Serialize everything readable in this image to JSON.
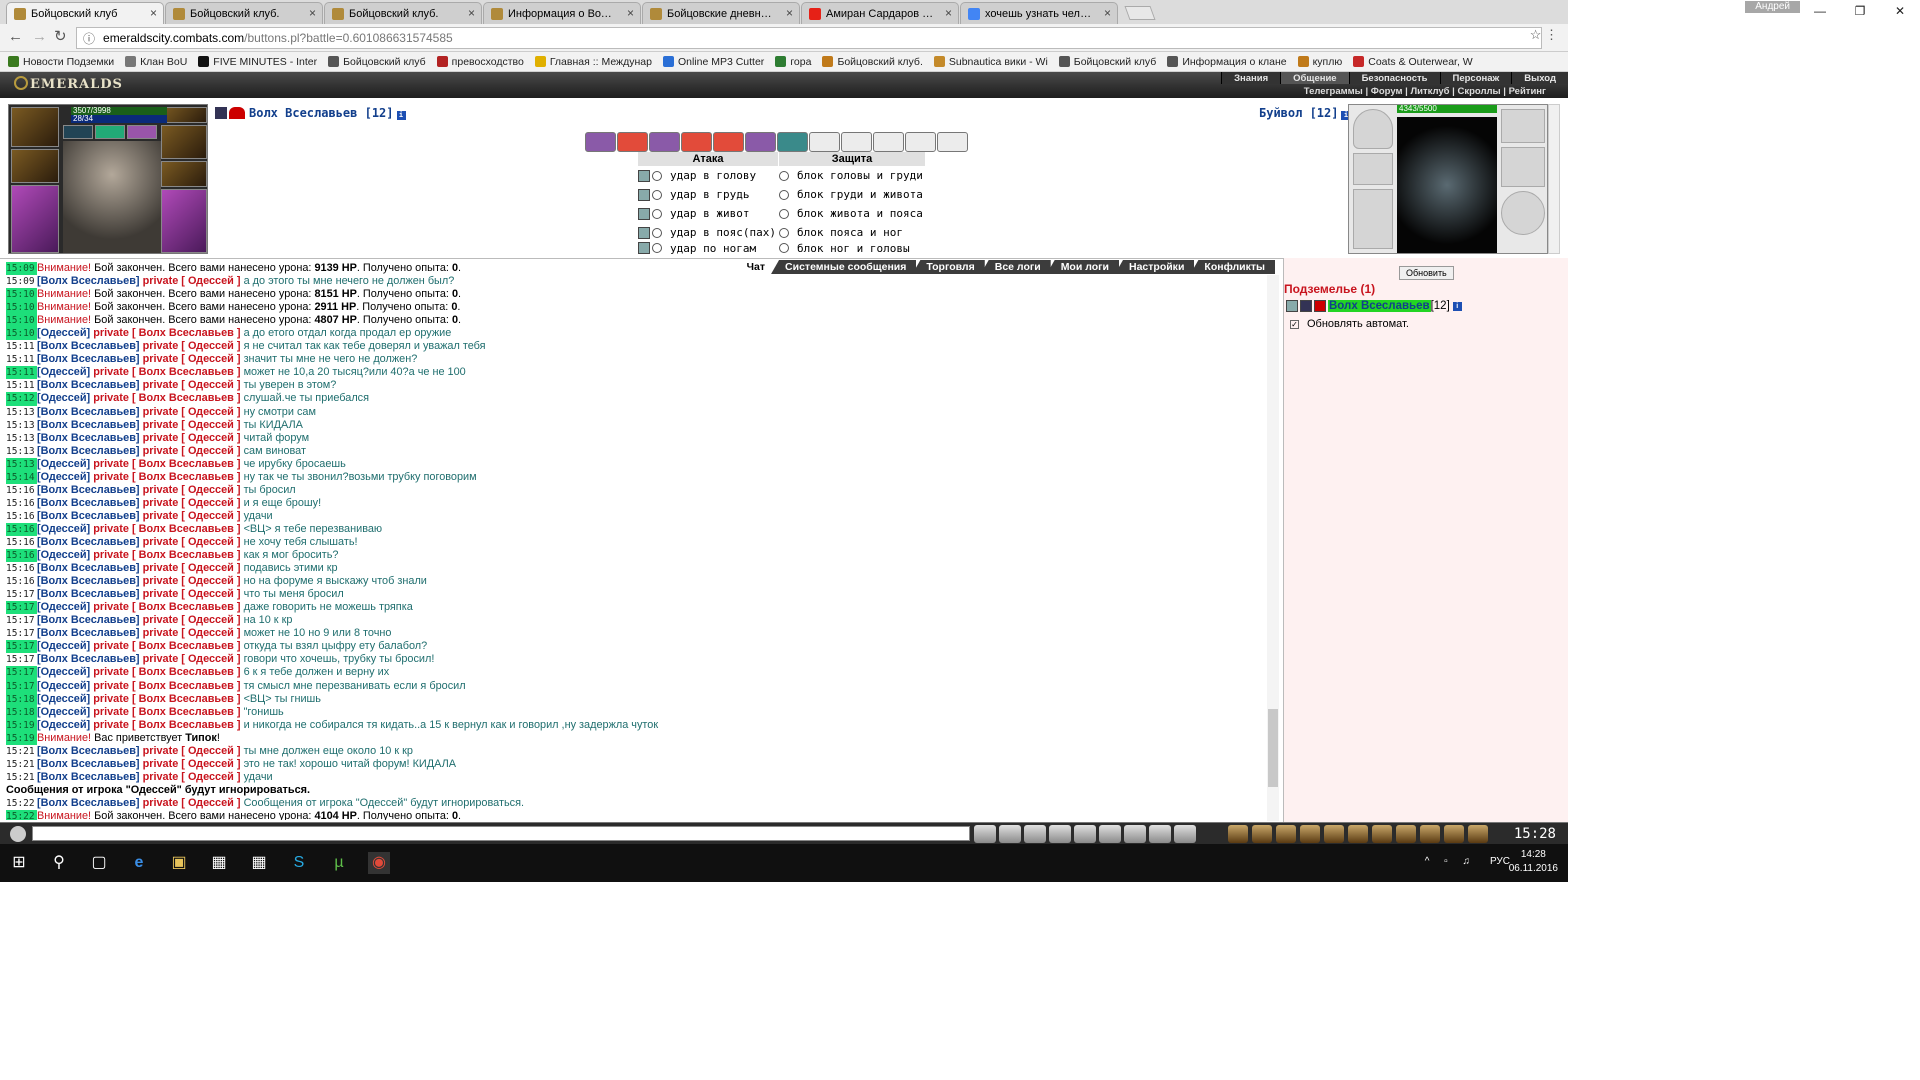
{
  "browser": {
    "tabs": [
      {
        "title": "Бойцовский клуб",
        "icon": "crossed-swords-icon",
        "active": true
      },
      {
        "title": "Бойцовский клуб.",
        "icon": "bear-claw-icon"
      },
      {
        "title": "Бойцовский клуб.",
        "icon": "bear-claw-icon"
      },
      {
        "title": "Информация о Волх Все",
        "icon": "crossed-swords-icon"
      },
      {
        "title": "Бойцовские дневники -",
        "icon": "bookmark-icon"
      },
      {
        "title": "Амиран Сардаров - Му",
        "icon": "youtube-icon"
      },
      {
        "title": "хочешь узнать человек",
        "icon": "google-icon"
      }
    ],
    "user": "Андрей",
    "url_host": "emeraldscity.combats.com",
    "url_rest": "/buttons.pl?battle=0.601086631574585",
    "bookmarks": [
      {
        "label": "Новости Подземки",
        "color": "#3a7a1f"
      },
      {
        "label": "Клан BoU",
        "color": "#777777"
      },
      {
        "label": "FIVE MINUTES - Inter",
        "color": "#111111"
      },
      {
        "label": "Бойцовский клуб",
        "color": "#555555"
      },
      {
        "label": "превосходство",
        "color": "#b22222"
      },
      {
        "label": "Главная :: Междунар",
        "color": "#e0b000"
      },
      {
        "label": "Online MP3 Cutter",
        "color": "#2a6fd6"
      },
      {
        "label": "гора",
        "color": "#2e7d32"
      },
      {
        "label": "Бойцовский клуб.",
        "color": "#c07a1a"
      },
      {
        "label": "Subnautica вики - Wi",
        "color": "#c48a2a"
      },
      {
        "label": "Бойцовский клуб",
        "color": "#555555"
      },
      {
        "label": "Информация о клане",
        "color": "#555555"
      },
      {
        "label": "куплю",
        "color": "#c07a1a"
      },
      {
        "label": "Coats & Outerwear, W",
        "color": "#c62828"
      }
    ]
  },
  "game": {
    "logo": "EMERALDS",
    "menu": [
      "Знания",
      "Общение",
      "Безопасность",
      "Персонаж",
      "Выход"
    ],
    "submenu": "Телеграммы | Форум | Литклуб | Скроллы | Рейтинг",
    "player": {
      "name": "Волх Всеславьев [12]",
      "hp": "3507/3998",
      "mana": "28/34"
    },
    "opponent": {
      "name": "Буйвол [12]",
      "hp": "4343/5500"
    },
    "attack_header": "Атака",
    "defense_header": "Защита",
    "attacks": [
      "удар в голову",
      "удар в грудь",
      "удар в живот",
      "удар в пояс(пах)",
      "удар по ногам"
    ],
    "defenses": [
      "блок головы и груди",
      "блок груди и живота",
      "блок живота и пояса",
      "блок пояса и ног",
      "блок ног и головы"
    ],
    "chat_tabs": [
      "Чат",
      "Системные сообщения",
      "Торговля",
      "Все логи",
      "Мои логи",
      "Настройки",
      "Конфликты"
    ],
    "chat_lines": [
      {
        "time": "15:09",
        "hl": true,
        "type": "warn",
        "text": "Бой закончен. Всего вами нанесено урона: ",
        "dmg": "9139 HP",
        "tail": ". Получено опыта: ",
        "exp": "0",
        "end": "."
      },
      {
        "time": "15:09",
        "type": "priv",
        "from": "Волх Всеславьев",
        "to": "Одессей",
        "text": "а до этого ты мне нечего не должен был?"
      },
      {
        "time": "15:10",
        "hl": true,
        "type": "warn",
        "text": "Бой закончен. Всего вами нанесено урона: ",
        "dmg": "8151 HP",
        "tail": ". Получено опыта: ",
        "exp": "0",
        "end": "."
      },
      {
        "time": "15:10",
        "hl": true,
        "type": "warn",
        "text": "Бой закончен. Всего вами нанесено урона: ",
        "dmg": "2911 HP",
        "tail": ". Получено опыта: ",
        "exp": "0",
        "end": "."
      },
      {
        "time": "15:10",
        "hl": true,
        "type": "warn",
        "text": "Бой закончен. Всего вами нанесено урона: ",
        "dmg": "4807 HP",
        "tail": ". Получено опыта: ",
        "exp": "0",
        "end": "."
      },
      {
        "time": "15:10",
        "hl": true,
        "type": "priv",
        "from": "Одессей",
        "to": "Волх Всеславьев",
        "text": "а до етого отдал когда продал ер оружие"
      },
      {
        "time": "15:11",
        "type": "priv",
        "from": "Волх Всеславьев",
        "to": "Одессей",
        "text": "я не считал так как тебе доверял и уважал тебя"
      },
      {
        "time": "15:11",
        "type": "priv",
        "from": "Волх Всеславьев",
        "to": "Одессей",
        "text": "значит ты мне не чего не должен?"
      },
      {
        "time": "15:11",
        "hl": true,
        "type": "priv",
        "from": "Одессей",
        "to": "Волх Всеславьев",
        "text": "может не 10,а 20 тысяц?или 40?а че не 100"
      },
      {
        "time": "15:11",
        "type": "priv",
        "from": "Волх Всеславьев",
        "to": "Одессей",
        "text": "ты уверен в этом?"
      },
      {
        "time": "15:12",
        "hl": true,
        "type": "priv",
        "from": "Одессей",
        "to": "Волх Всеславьев",
        "text": "слушай.че ты приебался"
      },
      {
        "time": "15:13",
        "type": "priv",
        "from": "Волх Всеславьев",
        "to": "Одессей",
        "text": "ну смотри сам"
      },
      {
        "time": "15:13",
        "type": "priv",
        "from": "Волх Всеславьев",
        "to": "Одессей",
        "text": "ты КИДАЛА"
      },
      {
        "time": "15:13",
        "type": "priv",
        "from": "Волх Всеславьев",
        "to": "Одессей",
        "text": "читай форум"
      },
      {
        "time": "15:13",
        "type": "priv",
        "from": "Волх Всеславьев",
        "to": "Одессей",
        "text": "сам виноват"
      },
      {
        "time": "15:13",
        "hl": true,
        "type": "priv",
        "from": "Одессей",
        "to": "Волх Всеславьев",
        "text": "че ирубку бросаешь"
      },
      {
        "time": "15:14",
        "hl": true,
        "type": "priv",
        "from": "Одессей",
        "to": "Волх Всеславьев",
        "text": "ну так че ты звонил?возьми трубку поговорим"
      },
      {
        "time": "15:16",
        "type": "priv",
        "from": "Волх Всеславьев",
        "to": "Одессей",
        "text": "ты бросил"
      },
      {
        "time": "15:16",
        "type": "priv",
        "from": "Волх Всеславьев",
        "to": "Одессей",
        "text": "и я еще брошу!"
      },
      {
        "time": "15:16",
        "type": "priv",
        "from": "Волх Всеславьев",
        "to": "Одессей",
        "text": "удачи"
      },
      {
        "time": "15:16",
        "hl": true,
        "type": "priv",
        "from": "Одессей",
        "to": "Волх Всеславьев",
        "text": "<ВЦ> я тебе перезваниваю"
      },
      {
        "time": "15:16",
        "type": "priv",
        "from": "Волх Всеславьев",
        "to": "Одессей",
        "text": "не хочу тебя слышать!"
      },
      {
        "time": "15:16",
        "hl": true,
        "type": "priv",
        "from": "Одессей",
        "to": "Волх Всеславьев",
        "text": "как я мог бросить?"
      },
      {
        "time": "15:16",
        "type": "priv",
        "from": "Волх Всеславьев",
        "to": "Одессей",
        "text": "подавись этими кр"
      },
      {
        "time": "15:16",
        "type": "priv",
        "from": "Волх Всеславьев",
        "to": "Одессей",
        "text": "но на форуме я выскажу чтоб знали"
      },
      {
        "time": "15:17",
        "type": "priv",
        "from": "Волх Всеславьев",
        "to": "Одессей",
        "text": "что ты меня бросил"
      },
      {
        "time": "15:17",
        "hl": true,
        "type": "priv",
        "from": "Одессей",
        "to": "Волх Всеславьев",
        "text": "даже говорить не можешь тряпка"
      },
      {
        "time": "15:17",
        "type": "priv",
        "from": "Волх Всеславьев",
        "to": "Одессей",
        "text": "на 10 к кр"
      },
      {
        "time": "15:17",
        "type": "priv",
        "from": "Волх Всеславьев",
        "to": "Одессей",
        "text": "может не 10 но 9 или 8 точно"
      },
      {
        "time": "15:17",
        "hl": true,
        "type": "priv",
        "from": "Одессей",
        "to": "Волх Всеславьев",
        "text": "откуда ты взял цыфру ету балабол?"
      },
      {
        "time": "15:17",
        "type": "priv",
        "from": "Волх Всеславьев",
        "to": "Одессей",
        "text": "говори что хочешь, трубку ты бросил!"
      },
      {
        "time": "15:17",
        "hl": true,
        "type": "priv",
        "from": "Одессей",
        "to": "Волх Всеславьев",
        "text": "6 к я тебе должен и верну их"
      },
      {
        "time": "15:17",
        "hl": true,
        "type": "priv",
        "from": "Одессей",
        "to": "Волх Всеславьев",
        "text": "тя смысл мне перезванивать если я бросил"
      },
      {
        "time": "15:18",
        "hl": true,
        "type": "priv",
        "from": "Одессей",
        "to": "Волх Всеславьев",
        "text": "<ВЦ> ты гнишь"
      },
      {
        "time": "15:18",
        "hl": true,
        "type": "priv",
        "from": "Одессей",
        "to": "Волх Всеславьев",
        "text": "\"гонишь"
      },
      {
        "time": "15:19",
        "hl": true,
        "type": "priv",
        "from": "Одессей",
        "to": "Волх Всеславьев",
        "text": "и никогда не собирался тя кидать..а 15 к вернул как и говорил ,ну задержла чуток"
      },
      {
        "time": "15:19",
        "hl": true,
        "type": "greet",
        "text": "Вас приветствует ",
        "bold": "Типок",
        "end": "!"
      },
      {
        "time": "15:21",
        "type": "priv",
        "from": "Волх Всеславьев",
        "to": "Одессей",
        "text": "ты мне должен еще около 10 к кр"
      },
      {
        "time": "15:21",
        "type": "priv",
        "from": "Волх Всеславьев",
        "to": "Одессей",
        "text": "это не так! хорошо читай форум! КИДАЛА"
      },
      {
        "time": "15:21",
        "type": "priv",
        "from": "Волх Всеславьев",
        "to": "Одессей",
        "text": "удачи"
      },
      {
        "time": "",
        "type": "sysbold",
        "text": "Сообщения от игрока \"Одессей\" будут игнорироваться."
      },
      {
        "time": "15:22",
        "type": "priv",
        "from": "Волх Всеславьев",
        "to": "Одессей",
        "text": "Сообщения от игрока \"Одессей\" будут игнорироваться."
      },
      {
        "time": "15:22",
        "hl": true,
        "type": "warn",
        "text": "Бой закончен. Всего вами нанесено урона: ",
        "dmg": "4104 HP",
        "tail": ". Получено опыта: ",
        "exp": "0",
        "end": "."
      }
    ],
    "warn_label": "Внимание!",
    "private_label": "private",
    "side": {
      "refresh": "Обновить",
      "room": "Подземелье (1)",
      "user_name": "Волх Всеславьев",
      "user_level": "[12]",
      "auto_label": "Обновлять автомат."
    },
    "clock": "15:28"
  },
  "taskbar": {
    "lang": "РУС",
    "time": "14:28",
    "date": "06.11.2016"
  },
  "colors": {
    "accent_green": "#1ddf7a",
    "private_red": "#c8141e",
    "name_blue": "#123f8c",
    "message_teal": "#1f6e6e"
  }
}
